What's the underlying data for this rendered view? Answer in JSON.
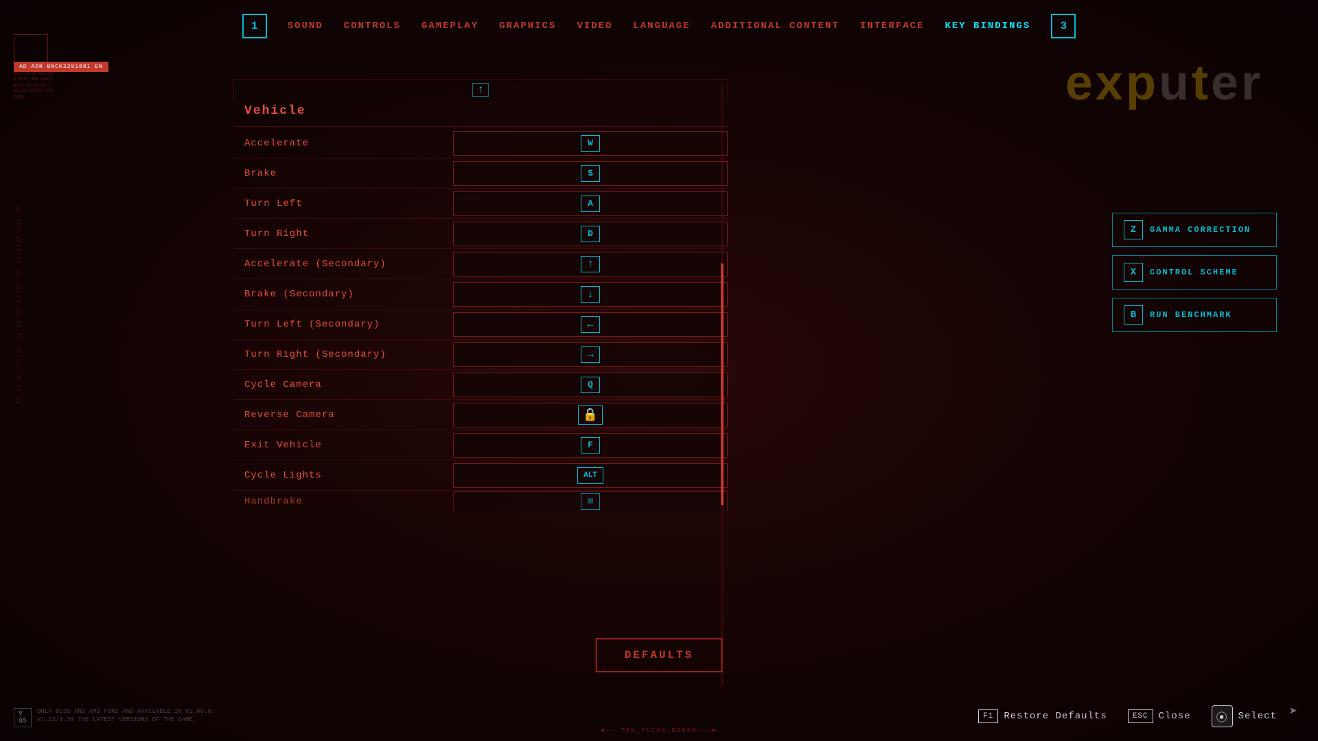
{
  "nav": {
    "box1_label": "1",
    "box3_label": "3",
    "items": [
      {
        "id": "sound",
        "label": "SOUND",
        "active": false
      },
      {
        "id": "controls",
        "label": "CONTROLS",
        "active": false
      },
      {
        "id": "gameplay",
        "label": "GAMEPLAY",
        "active": false
      },
      {
        "id": "graphics",
        "label": "GRAPHICS",
        "active": false
      },
      {
        "id": "video",
        "label": "VIDEO",
        "active": false
      },
      {
        "id": "language",
        "label": "LANGUAGE",
        "active": false
      },
      {
        "id": "additional_content",
        "label": "ADDITIONAL CONTENT",
        "active": false
      },
      {
        "id": "interface",
        "label": "INTERFACE",
        "active": false
      },
      {
        "id": "key_bindings",
        "label": "KEY BINDINGS",
        "active": true
      }
    ]
  },
  "watermark": {
    "text": "exputer"
  },
  "section": {
    "title": "Vehicle"
  },
  "bindings": [
    {
      "label": "Accelerate",
      "key": "W",
      "type": "letter"
    },
    {
      "label": "Brake",
      "key": "S",
      "type": "letter"
    },
    {
      "label": "Turn Left",
      "key": "A",
      "type": "letter"
    },
    {
      "label": "Turn Right",
      "key": "D",
      "type": "letter"
    },
    {
      "label": "Accelerate (Secondary)",
      "key": "↑",
      "type": "arrow"
    },
    {
      "label": "Brake (Secondary)",
      "key": "↓",
      "type": "arrow"
    },
    {
      "label": "Turn Left (Secondary)",
      "key": "←",
      "type": "arrow"
    },
    {
      "label": "Turn Right (Secondary)",
      "key": "→",
      "type": "arrow"
    },
    {
      "label": "Cycle Camera",
      "key": "Q",
      "type": "letter"
    },
    {
      "label": "Reverse Camera",
      "key": "🔒",
      "type": "icon"
    },
    {
      "label": "Exit Vehicle",
      "key": "F",
      "type": "letter"
    },
    {
      "label": "Cycle Lights",
      "key": "ALT",
      "type": "wide"
    },
    {
      "label": "Handbrake",
      "key": "▣",
      "type": "partial"
    }
  ],
  "quick_actions": [
    {
      "key": "Z",
      "label": "GAMMA CORRECTION"
    },
    {
      "key": "X",
      "label": "CONTROL SCHEME"
    },
    {
      "key": "B",
      "label": "RUN BENCHMARK"
    }
  ],
  "defaults_btn": {
    "label": "DEFAULTS"
  },
  "bottom_actions": [
    {
      "key": "F1",
      "label": "Restore Defaults",
      "type": "keyboard"
    },
    {
      "key": "ESC",
      "label": "Close",
      "type": "keyboard"
    },
    {
      "key": "⊙",
      "label": "Select",
      "type": "gamepad"
    }
  ],
  "version": {
    "label": "V\n85",
    "text": "ONLY DLSS AND AMD FSR2 AND AVAILABLE IN V1.60.6. V1.23/1.30 THE LATEST VERSIONS OF THE GAME."
  },
  "center_bottom": "◄—— TRK_TLCAS_B0008 ——►",
  "top_scroll_arrow": "↑"
}
